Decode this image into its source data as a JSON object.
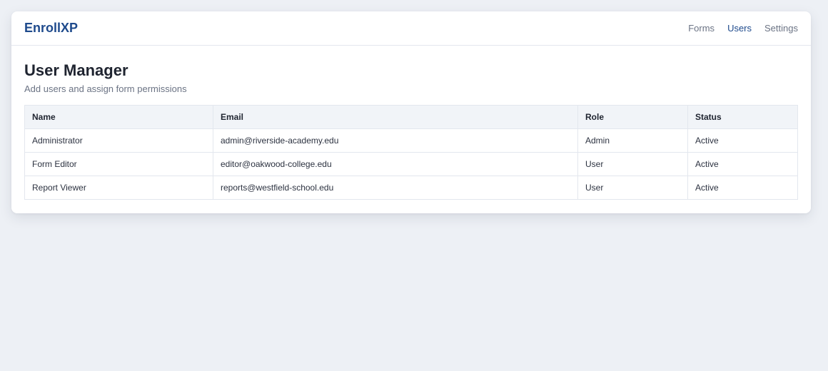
{
  "app": {
    "brand": "EnrollXP"
  },
  "nav": {
    "items": [
      {
        "label": "Forms",
        "active": false
      },
      {
        "label": "Users",
        "active": true
      },
      {
        "label": "Settings",
        "active": false
      }
    ]
  },
  "page": {
    "title": "User Manager",
    "subtitle": "Add users and assign form permissions"
  },
  "table": {
    "headers": [
      "Name",
      "Email",
      "Role",
      "Status"
    ],
    "rows": [
      [
        "Administrator",
        "admin@riverside-academy.edu",
        "Admin",
        "Active"
      ],
      [
        "Form Editor",
        "editor@oakwood-college.edu",
        "User",
        "Active"
      ],
      [
        "Report Viewer",
        "reports@westfield-school.edu",
        "User",
        "Active"
      ]
    ]
  },
  "colors": {
    "background": "#edf0f5",
    "brand": "#1e4a8c",
    "muted_text": "#6b7384",
    "table_header_bg": "#f1f4f8",
    "border": "#e3e7ee"
  }
}
